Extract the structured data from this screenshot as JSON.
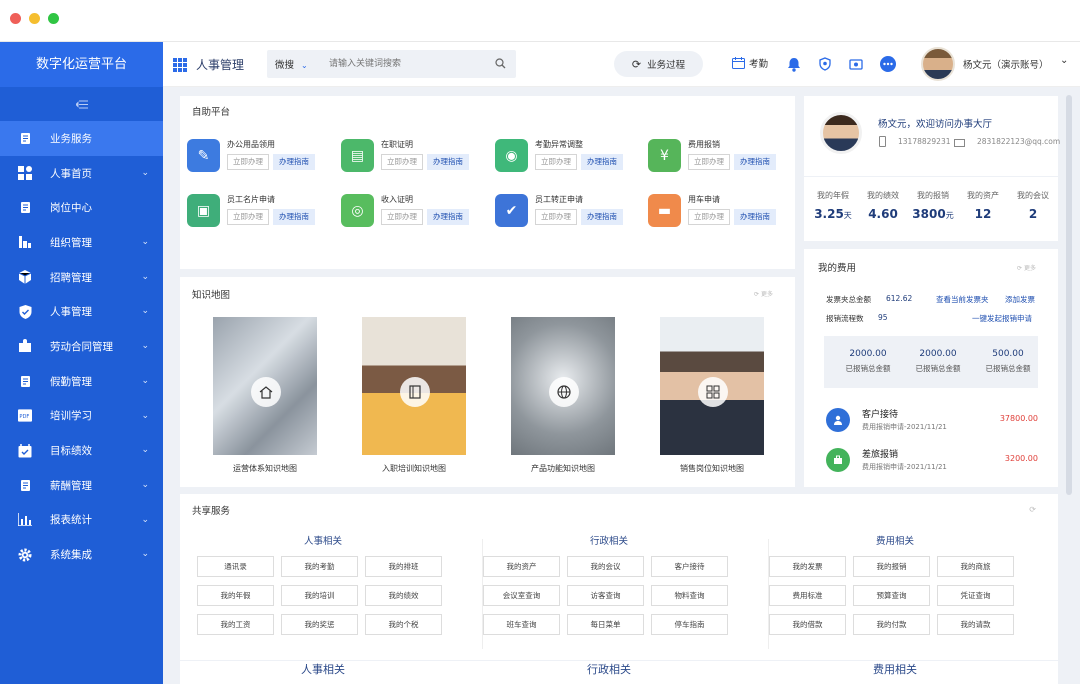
{
  "sidebar": {
    "brand": "数字化运营平台",
    "items": [
      {
        "label": "业务服务",
        "active": true,
        "chevron": false,
        "icon": "doc-icon"
      },
      {
        "label": "人事首页",
        "chevron": true,
        "icon": "grid-icon"
      },
      {
        "label": "岗位中心",
        "chevron": false,
        "icon": "doc-icon"
      },
      {
        "label": "组织管理",
        "chevron": true,
        "icon": "org-icon"
      },
      {
        "label": "招聘管理",
        "chevron": true,
        "icon": "cube-icon"
      },
      {
        "label": "人事管理",
        "chevron": true,
        "icon": "shield-icon"
      },
      {
        "label": "劳动合同管理",
        "chevron": true,
        "icon": "puzzle-icon"
      },
      {
        "label": "假勤管理",
        "chevron": true,
        "icon": "doc-icon"
      },
      {
        "label": "培训学习",
        "chevron": true,
        "icon": "pdf-icon"
      },
      {
        "label": "目标绩效",
        "chevron": true,
        "icon": "calendar-check-icon"
      },
      {
        "label": "薪酬管理",
        "chevron": true,
        "icon": "doc-icon"
      },
      {
        "label": "报表统计",
        "chevron": true,
        "icon": "bar-chart-icon"
      },
      {
        "label": "系统集成",
        "chevron": true,
        "icon": "gear-icon"
      }
    ]
  },
  "header": {
    "title": "人事管理",
    "search_scope": "微搜",
    "search_placeholder": "请输入关键词搜索",
    "process_button": "业务过程",
    "attendance": "考勤",
    "user_name": "杨文元（演示账号）"
  },
  "self_service": {
    "title": "自助平台",
    "btn_apply": "立即办理",
    "btn_guide": "办理指南",
    "items": [
      {
        "label": "办公用品领用",
        "color": "#3d7be0"
      },
      {
        "label": "在职证明",
        "color": "#4cb86a"
      },
      {
        "label": "考勤异常调整",
        "color": "#3fb87a"
      },
      {
        "label": "费用报销",
        "color": "#56b55a"
      },
      {
        "label": "员工名片申请",
        "color": "#3fae7a"
      },
      {
        "label": "收入证明",
        "color": "#58bd5e"
      },
      {
        "label": "员工转正申请",
        "color": "#3d74d8"
      },
      {
        "label": "用车申请",
        "color": "#f08a4b"
      }
    ]
  },
  "knowledge": {
    "title": "知识地图",
    "more": "更多",
    "cards": [
      {
        "label": "运营体系知识地图",
        "icon": "home-icon"
      },
      {
        "label": "入职培训知识地图",
        "icon": "notebook-icon"
      },
      {
        "label": "产品功能知识地图",
        "icon": "globe-icon"
      },
      {
        "label": "销售岗位知识地图",
        "icon": "apps-icon"
      }
    ]
  },
  "profile": {
    "greeting": "杨文元，欢迎访问办事大厅",
    "phone": "13178829231",
    "email": "2831822123@qq.com",
    "stats": [
      {
        "label": "我的年假",
        "value": "3.25",
        "unit": "天"
      },
      {
        "label": "我的绩效",
        "value": "4.60",
        "unit": ""
      },
      {
        "label": "我的报销",
        "value": "3800",
        "unit": "元"
      },
      {
        "label": "我的资产",
        "value": "12",
        "unit": ""
      },
      {
        "label": "我的会议",
        "value": "2",
        "unit": ""
      }
    ]
  },
  "expenses": {
    "title": "我的费用",
    "more": "更多",
    "invoice_total_label": "发票夹总金额",
    "invoice_total_value": "612.62",
    "view_invoices": "查看当前发票夹",
    "add_invoice": "添加发票",
    "flow_count_label": "报销流程数",
    "flow_count_value": "95",
    "start_reimburse": "一键发起报销申请",
    "amounts": [
      {
        "value": "2000.00",
        "label": "已报销总金额"
      },
      {
        "value": "2000.00",
        "label": "已报销总金额"
      },
      {
        "value": "500.00",
        "label": "已报销总金额"
      }
    ],
    "records": [
      {
        "title": "客户接待",
        "sub": "费用报销申请-2021/11/21",
        "amount": "37800.00",
        "color": "#2f6fd8",
        "icon": "user-icon"
      },
      {
        "title": "差旅报销",
        "sub": "费用报销申请-2021/11/21",
        "amount": "3200.00",
        "color": "#43b35b",
        "icon": "briefcase-icon"
      }
    ]
  },
  "shared": {
    "title": "共享服务",
    "groups": [
      {
        "title": "人事相关",
        "buttons": [
          "通讯录",
          "我的考勤",
          "我的排班",
          "我的年假",
          "我的培训",
          "我的绩效",
          "我的工资",
          "我的奖惩",
          "我的个税"
        ]
      },
      {
        "title": "行政相关",
        "buttons": [
          "我的资产",
          "我的会议",
          "客户接待",
          "会议室查询",
          "访客查询",
          "物料查询",
          "班车查询",
          "每日菜单",
          "停车指南"
        ]
      },
      {
        "title": "费用相关",
        "buttons": [
          "我的发票",
          "我的报销",
          "我的商旅",
          "费用标准",
          "预算查询",
          "凭证查询",
          "我的借款",
          "我的付款",
          "我的请款"
        ]
      }
    ],
    "footer_titles": [
      "人事相关",
      "行政相关",
      "费用相关"
    ]
  },
  "colors": {
    "sidebar": "#1f5ed6",
    "accent": "#2b6be8",
    "amount_red": "#e0403a"
  }
}
